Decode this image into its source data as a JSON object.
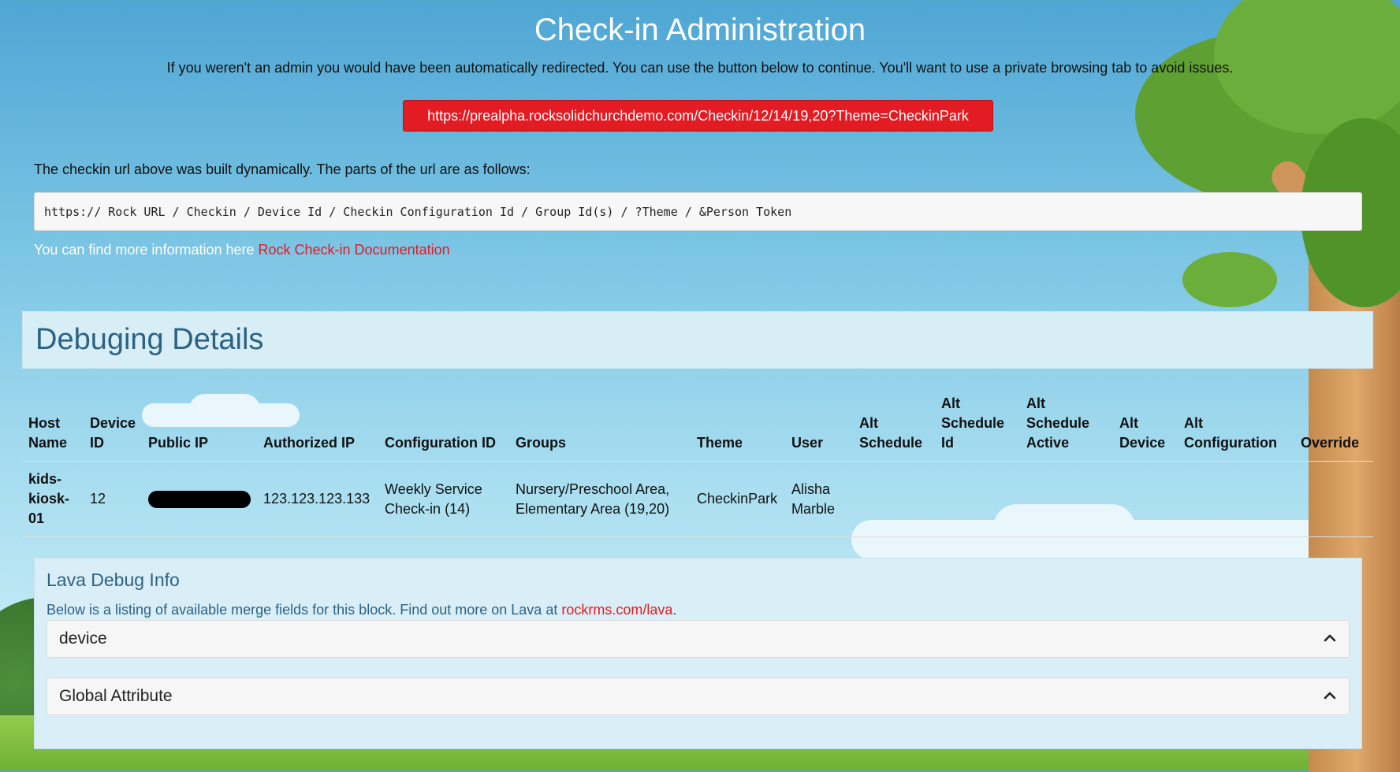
{
  "header": {
    "title": "Check-in Administration",
    "subtitle": "If you weren't an admin you would have been automatically redirected. You can use the button below to continue. You'll want to use a private browsing tab to avoid issues.",
    "checkin_url": "https://prealpha.rocksolidchurchdemo.com/Checkin/12/14/19,20?Theme=CheckinPark"
  },
  "intro": {
    "text": "The checkin url above was built dynamically. The parts of the url are as follows:",
    "url_parts": "https:// Rock URL / Checkin / Device Id / Checkin Configuration Id / Group Id(s) / ?Theme / &Person Token",
    "more_info_prefix": "You can find more information here ",
    "more_info_link": "Rock Check-in Documentation"
  },
  "debug": {
    "title": "Debuging Details",
    "columns": [
      "Host Name",
      "Device ID",
      "Public IP",
      "Authorized IP",
      "Configuration ID",
      "Groups",
      "Theme",
      "User",
      "Alt Schedule",
      "Alt Schedule Id",
      "Alt Schedule Active",
      "Alt Device",
      "Alt Configuration",
      "Override"
    ],
    "row": {
      "host_name": "kids-kiosk-01",
      "device_id": "12",
      "authorized_ip": "123.123.123.133",
      "configuration_id": "Weekly Service Check-in (14)",
      "groups": "Nursery/Preschool Area, Elementary Area (19,20)",
      "theme": "CheckinPark",
      "user": "Alisha Marble"
    }
  },
  "lava": {
    "title": "Lava Debug Info",
    "desc_prefix": "Below is a listing of available merge fields for this block. Find out more on Lava at ",
    "desc_link": "rockrms.com/lava",
    "desc_suffix": ".",
    "panels": [
      "device",
      "Global Attribute"
    ]
  },
  "colors": {
    "accent_red": "#e31b23",
    "heading_blue": "#2d6283",
    "panel_bg": "#d9eef6"
  },
  "icons": [
    "chevron-up-icon"
  ]
}
